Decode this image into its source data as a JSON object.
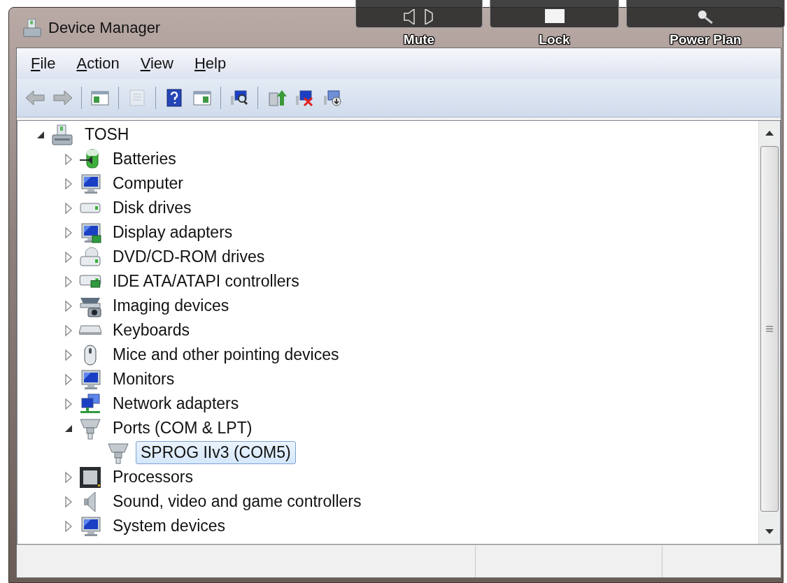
{
  "window": {
    "title": "Device Manager"
  },
  "thumbnail_buttons": [
    {
      "label": "Mute"
    },
    {
      "label": "Lock"
    },
    {
      "label": "Power Plan"
    }
  ],
  "menu": [
    "File",
    "Action",
    "View",
    "Help"
  ],
  "toolbar": [
    {
      "kind": "back",
      "disabled": true
    },
    {
      "kind": "forward",
      "disabled": true
    },
    {
      "kind": "sep"
    },
    {
      "kind": "tree-pane",
      "disabled": false
    },
    {
      "kind": "sep"
    },
    {
      "kind": "properties",
      "disabled": true
    },
    {
      "kind": "sep"
    },
    {
      "kind": "help",
      "disabled": false
    },
    {
      "kind": "action-pane",
      "disabled": false
    },
    {
      "kind": "sep"
    },
    {
      "kind": "scan",
      "disabled": false
    },
    {
      "kind": "sep"
    },
    {
      "kind": "update",
      "disabled": false
    },
    {
      "kind": "uninstall",
      "disabled": false
    },
    {
      "kind": "disable",
      "disabled": false
    }
  ],
  "tree": {
    "label": "TOSH",
    "kind": "laptop",
    "expanded": true,
    "selected": false,
    "children": [
      {
        "label": "Batteries",
        "kind": "battery",
        "expanded": false,
        "selected": false
      },
      {
        "label": "Computer",
        "kind": "computer",
        "expanded": false,
        "selected": false
      },
      {
        "label": "Disk drives",
        "kind": "drive",
        "expanded": false,
        "selected": false
      },
      {
        "label": "Display adapters",
        "kind": "display",
        "expanded": false,
        "selected": false
      },
      {
        "label": "DVD/CD-ROM drives",
        "kind": "disc",
        "expanded": false,
        "selected": false
      },
      {
        "label": "IDE ATA/ATAPI controllers",
        "kind": "controller",
        "expanded": false,
        "selected": false
      },
      {
        "label": "Imaging devices",
        "kind": "camera",
        "expanded": false,
        "selected": false
      },
      {
        "label": "Keyboards",
        "kind": "keyboard",
        "expanded": false,
        "selected": false
      },
      {
        "label": "Mice and other pointing devices",
        "kind": "mouse",
        "expanded": false,
        "selected": false
      },
      {
        "label": "Monitors",
        "kind": "monitor",
        "expanded": false,
        "selected": false
      },
      {
        "label": "Network adapters",
        "kind": "network",
        "expanded": false,
        "selected": false
      },
      {
        "label": "Ports (COM & LPT)",
        "kind": "port",
        "expanded": true,
        "selected": false,
        "children": [
          {
            "label": "SPROG IIv3 (COM5)",
            "kind": "port",
            "selected": true
          }
        ]
      },
      {
        "label": "Processors",
        "kind": "chip",
        "expanded": false,
        "selected": false
      },
      {
        "label": "Sound, video and game controllers",
        "kind": "speaker",
        "expanded": false,
        "selected": false
      },
      {
        "label": "System devices",
        "kind": "computer",
        "expanded": false,
        "selected": false
      }
    ]
  }
}
